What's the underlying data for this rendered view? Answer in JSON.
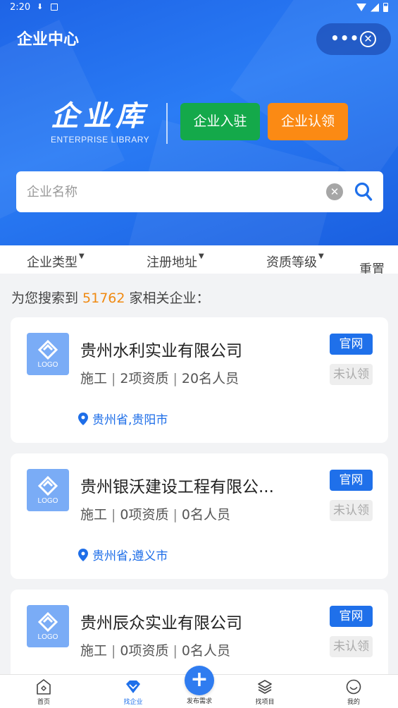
{
  "status_bar": {
    "time": "2:20"
  },
  "header": {
    "title": "企业中心",
    "more_label": "•••",
    "close_label": "✕"
  },
  "brand": {
    "title_cn": "企业库",
    "title_en": "ENTERPRISE LIBRARY"
  },
  "actions": {
    "join_label": "企业入驻",
    "claim_label": "企业认领"
  },
  "search": {
    "placeholder": "企业名称",
    "value": ""
  },
  "filters": {
    "type_label": "企业类型",
    "address_label": "注册地址",
    "qualification_label": "资质等级",
    "reset_label": "重置"
  },
  "result": {
    "prefix": "为您搜索到",
    "count": "51762",
    "suffix": "家相关企业："
  },
  "companies": [
    {
      "name": "贵州水利实业有限公司",
      "category": "施工",
      "qualifications": "2项资质",
      "staff": "20名人员",
      "location": "贵州省,贵阳市",
      "website_label": "官网",
      "claim_status": "未认领",
      "logo_text": "LOGO"
    },
    {
      "name": "贵州银沃建设工程有限公...",
      "category": "施工",
      "qualifications": "0项资质",
      "staff": "0名人员",
      "location": "贵州省,遵义市",
      "website_label": "官网",
      "claim_status": "未认领",
      "logo_text": "LOGO"
    },
    {
      "name": "贵州辰众实业有限公司",
      "category": "施工",
      "qualifications": "0项资质",
      "staff": "0名人员",
      "location": "",
      "website_label": "官网",
      "claim_status": "未认领",
      "logo_text": "LOGO"
    }
  ],
  "tabbar": {
    "home": "首页",
    "find_company": "找企业",
    "publish": "发布需求",
    "find_project": "找项目",
    "mine": "我的",
    "active_tab": "find_company"
  },
  "colors": {
    "primary": "#1f70ea",
    "join_green": "#14a94a",
    "claim_orange": "#fb8a14",
    "count_orange": "#f08a12"
  }
}
